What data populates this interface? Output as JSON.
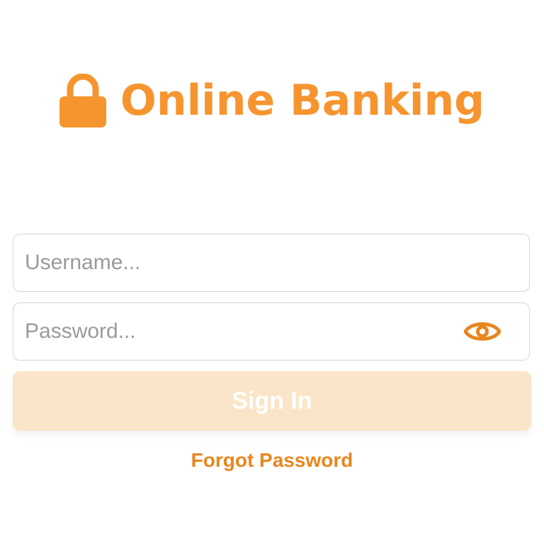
{
  "brand": {
    "title": "Online Banking",
    "icon": "lock-icon",
    "color": "#f6952f"
  },
  "login_form": {
    "username_placeholder": "Username...",
    "username_value": "",
    "password_placeholder": "Password...",
    "password_value": "",
    "password_toggle_icon": "eye-icon",
    "sign_in_label": "Sign In",
    "sign_in_color": "#fbe5c8",
    "forgot_password_label": "Forgot Password",
    "link_color": "#e8861f"
  }
}
